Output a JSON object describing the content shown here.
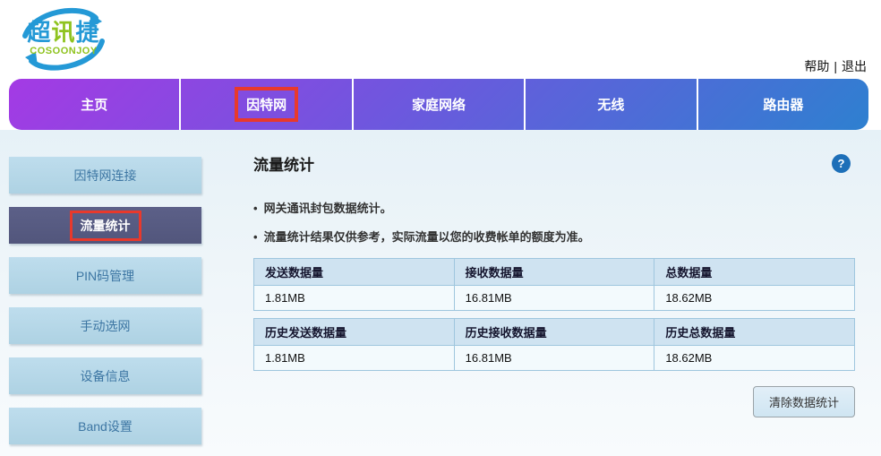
{
  "header": {
    "logo": {
      "char1": "超",
      "char2": "讯",
      "char3": "捷",
      "subtitle": "COSOONJOY"
    },
    "links": {
      "help": "帮助",
      "separator": "|",
      "logout": "退出"
    }
  },
  "nav": {
    "tabs": [
      {
        "label": "主页",
        "annotated": false
      },
      {
        "label": "因特网",
        "annotated": true
      },
      {
        "label": "家庭网络",
        "annotated": false
      },
      {
        "label": "无线",
        "annotated": false
      },
      {
        "label": "路由器",
        "annotated": false
      }
    ]
  },
  "sidebar": {
    "items": [
      {
        "label": "因特网连接",
        "selected": false
      },
      {
        "label": "流量统计",
        "selected": true,
        "annotated": true
      },
      {
        "label": "PIN码管理",
        "selected": false
      },
      {
        "label": "手动选网",
        "selected": false
      },
      {
        "label": "设备信息",
        "selected": false
      },
      {
        "label": "Band设置",
        "selected": false
      }
    ]
  },
  "content": {
    "title": "流量统计",
    "help_icon": "?",
    "notes": [
      "网关通讯封包数据统计。",
      "流量统计结果仅供参考，实际流量以您的收费帐单的额度为准。"
    ],
    "tables": [
      {
        "headers": [
          "发送数据量",
          "接收数据量",
          "总数据量"
        ],
        "rows": [
          [
            "1.81MB",
            "16.81MB",
            "18.62MB"
          ]
        ]
      },
      {
        "headers": [
          "历史发送数据量",
          "历史接收数据量",
          "历史总数据量"
        ],
        "rows": [
          [
            "1.81MB",
            "16.81MB",
            "18.62MB"
          ]
        ]
      }
    ],
    "clear_button": "清除数据统计"
  },
  "colors": {
    "nav_gradient_start": "#a43ae4",
    "nav_gradient_end": "#2e80d0",
    "annotation_red": "#e8392c",
    "sidebar_item_bg": "#b5d5e6",
    "sidebar_item_text": "#3d76a3",
    "sidebar_selected_bg": "#575b82",
    "table_header_bg": "#cfe3f1",
    "table_row_bg": "#f3fafd",
    "table_border": "#9fc6de",
    "page_lower_bg": "#e9f3f8",
    "help_icon_bg": "#1d6fb8",
    "logo_blue": "#2499d6",
    "logo_green": "#8fc31f"
  }
}
